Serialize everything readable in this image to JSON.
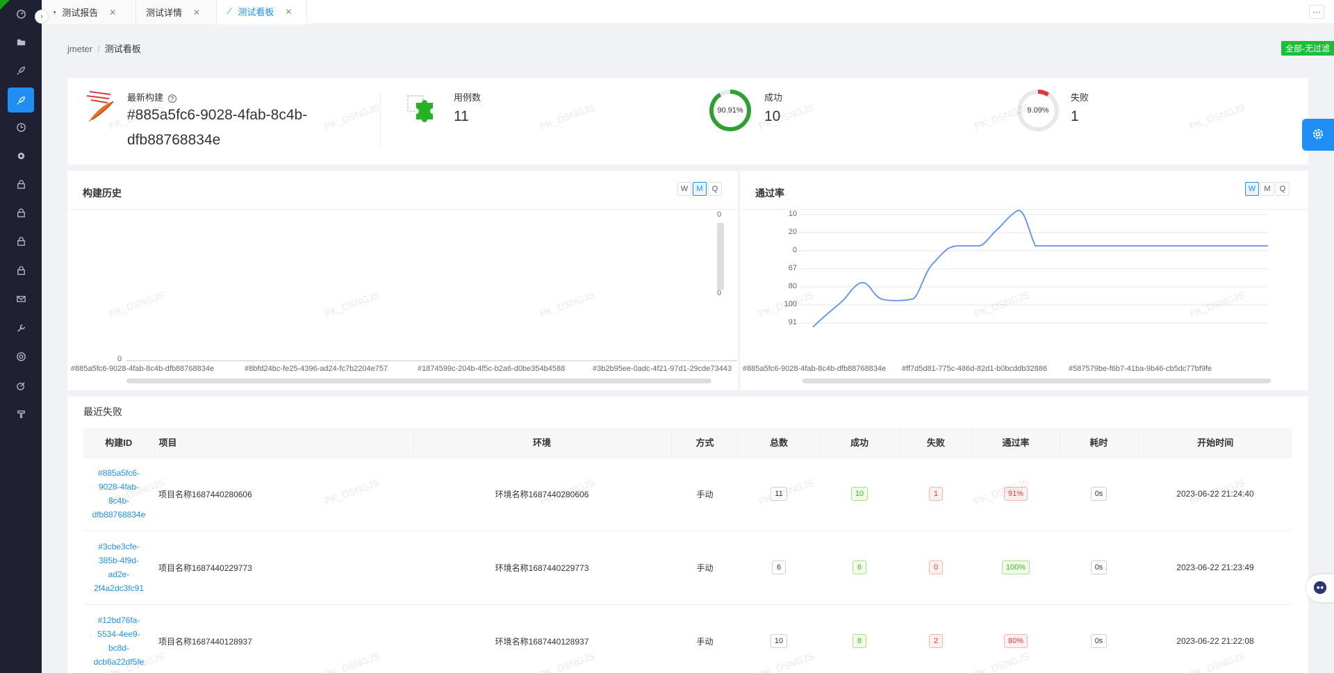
{
  "tabs": [
    {
      "label": "测试报告",
      "icon": "pie-chart-icon"
    },
    {
      "label": "测试详情",
      "icon": ""
    },
    {
      "label": "测试看板",
      "icon": "line-chart-icon",
      "active": true
    }
  ],
  "breadcrumb": {
    "root": "jmeter",
    "current": "测试看板"
  },
  "filter_badge": "全部-无过滤",
  "summary": {
    "latest_build_label": "最新构建",
    "latest_build_id_line1": "#885a5fc6-9028-4fab-8c4b-",
    "latest_build_id_line2": "dfb88768834e",
    "cases_label": "用例数",
    "cases_value": "11",
    "success_label": "成功",
    "success_value": "10",
    "success_pct": "90.91%",
    "success_ratio": 0.9091,
    "fail_label": "失败",
    "fail_value": "1",
    "fail_pct": "9.09%",
    "fail_ratio": 0.0909
  },
  "build_history": {
    "title": "构建历史",
    "periods": [
      "W",
      "M",
      "Q"
    ],
    "active_period": "M",
    "y_right_top": "0",
    "y_right_bottom": "0",
    "y_left": "0",
    "x_labels": [
      "#885a5fc6-9028-4fab-8c4b-dfb88768834e",
      "#8bfd24bc-fe25-4396-ad24-fc7b2204e757",
      "#1874599c-204b-4f5c-b2a6-d0be354b4588",
      "#3b2b95ee-0adc-4f21-97d1-29cde73443"
    ]
  },
  "pass_rate": {
    "title": "通过率",
    "periods": [
      "W",
      "M",
      "Q"
    ],
    "active_period": "W",
    "y_labels": [
      "10",
      "20",
      "0",
      "67",
      "80",
      "100",
      "91"
    ],
    "x_labels": [
      "#885a5fc6-9028-4fab-8c4b-dfb88768834e",
      "#ff7d5d81-775c-486d-82d1-b0bcddb32886",
      "#587579be-f6b7-41ba-9b46-cb5dc77bf9fe"
    ]
  },
  "recent_failures": {
    "title": "最近失败",
    "columns": [
      "构建ID",
      "项目",
      "环境",
      "方式",
      "总数",
      "成功",
      "失败",
      "通过率",
      "耗时",
      "开始时间"
    ],
    "rows": [
      {
        "id_lines": [
          "#885a5fc6-",
          "9028-4fab-",
          "8c4b-",
          "dfb88768834e"
        ],
        "project": "项目名称1687440280606",
        "env": "环境名称1687440280606",
        "mode": "手动",
        "total": "11",
        "success": "10",
        "fail": "1",
        "rate": "91%",
        "duration": "0s",
        "start": "2023-06-22 21:24:40"
      },
      {
        "id_lines": [
          "#3cbe3cfe-",
          "385b-4f9d-",
          "ad2e-",
          "2f4a2dc3fc91"
        ],
        "project": "项目名称1687440229773",
        "env": "环境名称1687440229773",
        "mode": "手动",
        "total": "6",
        "success": "6",
        "fail": "0",
        "rate": "100%",
        "duration": "0s",
        "start": "2023-06-22 21:23:49"
      },
      {
        "id_lines": [
          "#12bd76fa-",
          "5534-4ee9-",
          "bc8d-",
          "dcb6a22df5fe"
        ],
        "project": "项目名称1687440128937",
        "env": "环境名称1687440128937",
        "mode": "手动",
        "total": "10",
        "success": "8",
        "fail": "2",
        "rate": "80%",
        "duration": "0s",
        "start": "2023-06-22 21:22:08"
      }
    ]
  },
  "watermark": "PK_DSNGJS",
  "colors": {
    "accent": "#1f8ff5",
    "success": "#2ea12e",
    "fail": "#e0383a",
    "sidebar": "#1f2133",
    "badge": "#19be3a"
  }
}
